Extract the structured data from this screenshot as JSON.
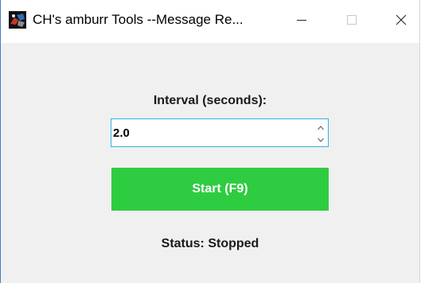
{
  "window": {
    "title": "CH's amburr Tools --Message Re...",
    "icon": "app-logo-icon",
    "controls": {
      "minimize_icon": "minimize-icon",
      "maximize_icon": "maximize-icon",
      "close_icon": "close-icon"
    }
  },
  "form": {
    "interval_label": "Interval (seconds):",
    "interval_value": "2.0",
    "spin_up_icon": "chevron-up-icon",
    "spin_down_icon": "chevron-down-icon"
  },
  "start_button": {
    "label": "Start (F9)",
    "color": "#2ecc40"
  },
  "status": {
    "text": "Status: Stopped"
  },
  "colors": {
    "window_background": "#f0f0f0",
    "titlebar_background": "#ffffff",
    "input_border_focus": "#2fb2e6"
  }
}
